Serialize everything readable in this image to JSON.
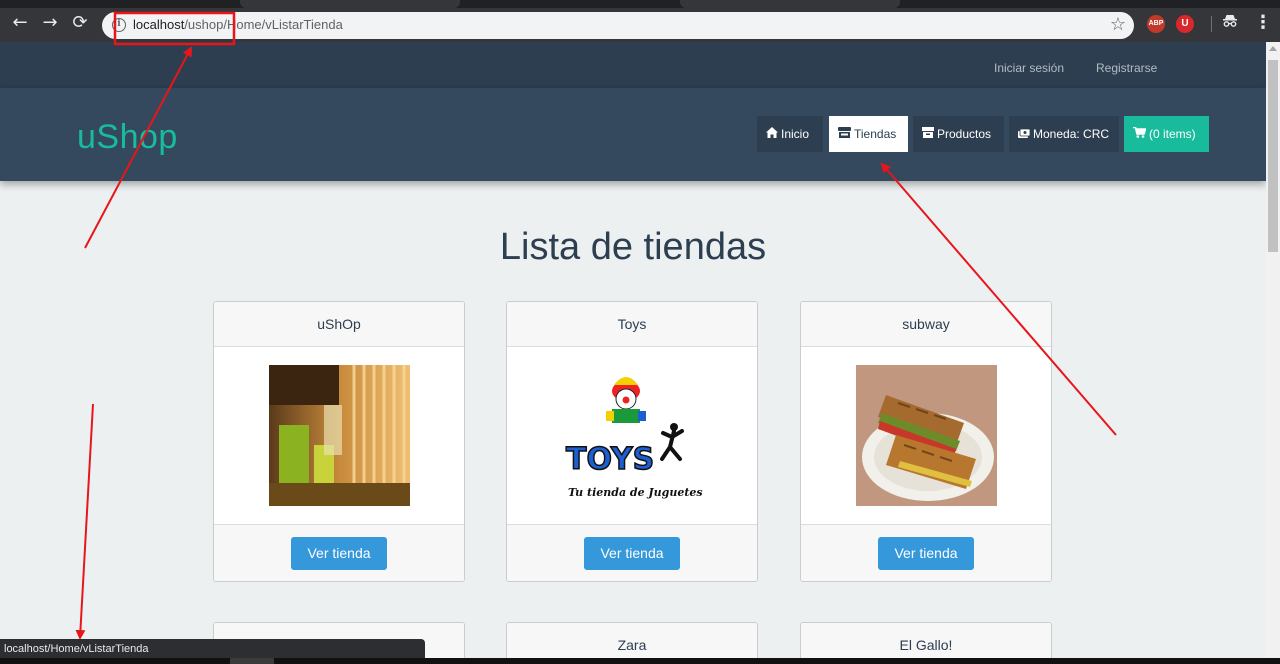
{
  "browser": {
    "url_host": "localhost",
    "url_path": "/ushop/Home/vListarTienda",
    "back_icon": "arrow-left-icon",
    "forward_icon": "arrow-right-icon",
    "reload_icon": "reload-icon",
    "extensions": [
      "adblock-plus-icon",
      "ublock-icon",
      "incognito-icon"
    ],
    "abp_label": "ABP",
    "ub_label": "U"
  },
  "topbar": {
    "login": "Iniciar sesión",
    "register": "Registrarse"
  },
  "header": {
    "brand": "uShop",
    "nav": [
      {
        "label": "Inicio",
        "icon": "home-icon"
      },
      {
        "label": "Tiendas",
        "icon": "store-icon",
        "active": true
      },
      {
        "label": "Productos",
        "icon": "box-icon"
      },
      {
        "label": "Moneda: CRC",
        "icon": "money-icon"
      },
      {
        "label": "(0 items)",
        "icon": "cart-icon"
      }
    ]
  },
  "main": {
    "title": "Lista de tiendas",
    "stores": [
      {
        "name": "uShOp",
        "button": "Ver tienda",
        "image": "restaurant-interior-photo"
      },
      {
        "name": "Toys",
        "button": "Ver tienda",
        "image": "toys-logo",
        "logo_text": "TOYS",
        "logo_tagline": "Tu tienda de Juguetes"
      },
      {
        "name": "subway",
        "button": "Ver tienda",
        "image": "sandwich-photo"
      },
      {
        "name": "",
        "button": ""
      },
      {
        "name": "Zara",
        "button": ""
      },
      {
        "name": "El Gallo!",
        "button": ""
      }
    ]
  },
  "statusbar": {
    "text": "localhost/Home/vListarTienda"
  },
  "colors": {
    "primary": "#2c3e50",
    "header": "#34495e",
    "accent": "#18bc9c",
    "button": "#3498db",
    "annotation": "#e8151b"
  }
}
